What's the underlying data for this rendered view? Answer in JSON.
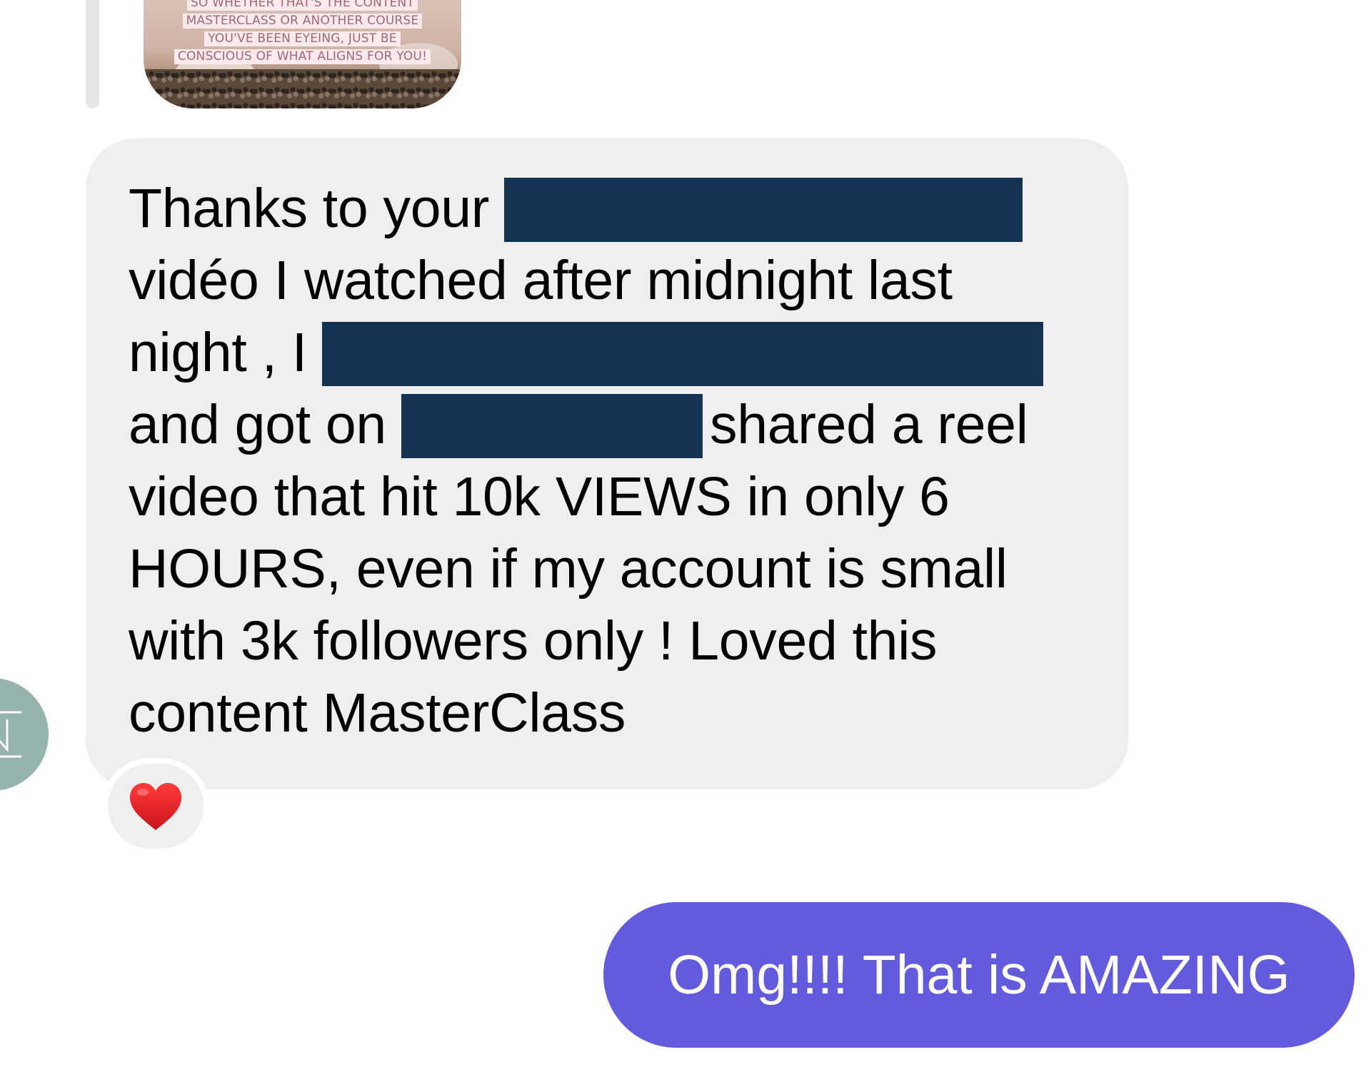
{
  "thread": {
    "reply_story": {
      "caption_lines": [
        "SO WHETHER THAT'S THE CONTENT",
        "MASTERCLASS OR ANOTHER COURSE",
        "YOU'VE BEEN EYEING, JUST BE",
        "CONSCIOUS OF WHAT ALIGNS FOR YOU!"
      ]
    },
    "incoming_message": {
      "segments": [
        "Thanks to your ",
        " vidéo I watched after midnight last night , I ",
        " and got on ",
        "shared a reel video that hit 10k VIEWS in only 6 HOURS, even if my account is small with 3k followers only ! Loved this content MasterClass"
      ],
      "redacted_color": "#153454",
      "bubble_color": "#efefef"
    },
    "reaction": {
      "emoji": "heart-icon",
      "color": "#e0212b"
    },
    "outgoing_message": {
      "text": "Omg!!!! That is AMAZING",
      "bubble_color": "#635bde"
    }
  }
}
